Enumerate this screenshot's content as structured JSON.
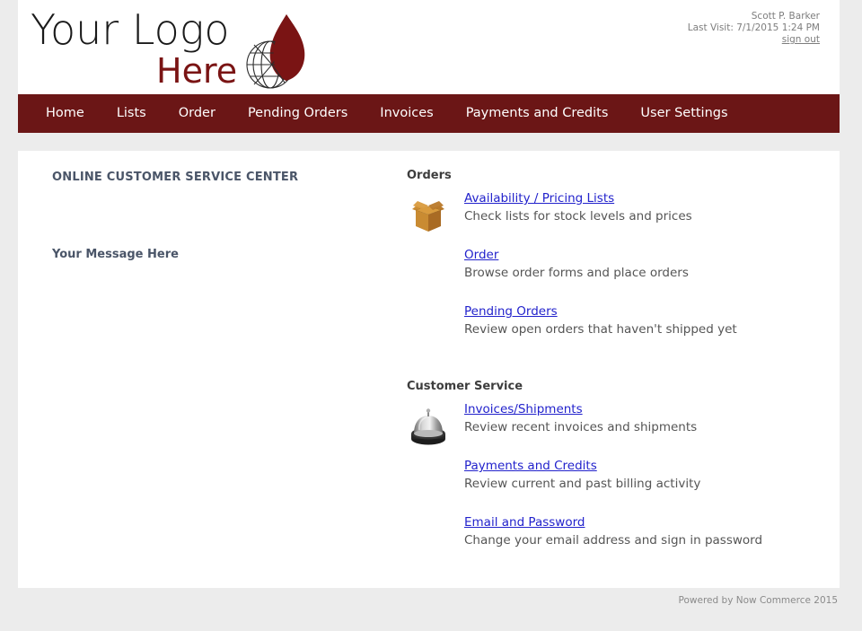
{
  "header": {
    "logo": {
      "line1": "Your Logo",
      "line2": "Here",
      "mark_icon": "flame-globe-logo-icon",
      "flame_color": "#7a1414"
    },
    "user": {
      "name": "Scott P. Barker",
      "last_visit": "Last Visit: 7/1/2015 1:24 PM",
      "sign_out_label": "sign out"
    }
  },
  "nav": {
    "background_color": "#6b1616",
    "items": [
      {
        "label": "Home"
      },
      {
        "label": "Lists"
      },
      {
        "label": "Order"
      },
      {
        "label": "Pending Orders"
      },
      {
        "label": "Invoices"
      },
      {
        "label": "Payments and Credits"
      },
      {
        "label": "User Settings"
      }
    ]
  },
  "main": {
    "left": {
      "title": "ONLINE CUSTOMER SERVICE CENTER",
      "message": "Your Message Here"
    },
    "sections": [
      {
        "title": "Orders",
        "icon": "open-cardboard-box-icon",
        "items": [
          {
            "link": "Availability / Pricing Lists",
            "description": "Check lists for stock levels and prices"
          },
          {
            "link": "Order",
            "description": "Browse order forms and place orders"
          },
          {
            "link": "Pending Orders",
            "description": "Review open orders that haven't shipped yet"
          }
        ]
      },
      {
        "title": "Customer Service",
        "icon": "service-bell-icon",
        "items": [
          {
            "link": "Invoices/Shipments",
            "description": "Review recent invoices and shipments"
          },
          {
            "link": "Payments and Credits",
            "description": "Review current and past billing activity"
          },
          {
            "link": "Email and Password",
            "description": "Change your email address and sign in password"
          }
        ]
      }
    ]
  },
  "footer": {
    "text": "Powered by Now Commerce 2015"
  },
  "colors": {
    "brand_maroon": "#6b1616",
    "link_blue": "#2222cc",
    "page_background": "#ececec",
    "heading_slate": "#4a5568"
  }
}
